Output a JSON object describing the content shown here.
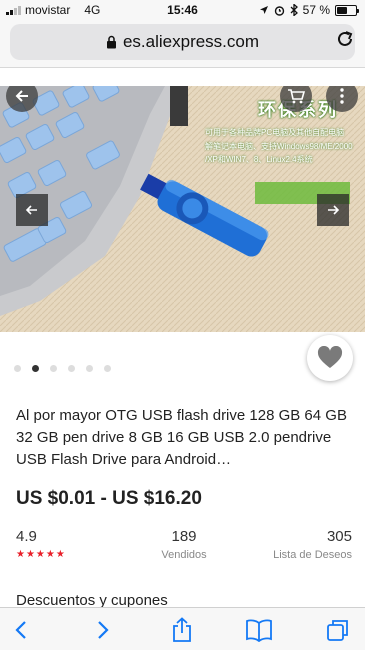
{
  "status_bar": {
    "carrier": "movistar",
    "network": "4G",
    "time": "15:46",
    "battery_percent": "57 %",
    "battery_level": 0.57
  },
  "browser": {
    "url": "es.aliexpress.com"
  },
  "gallery": {
    "image_text_title": "环保系列",
    "image_text_line1": "可用于各种品牌PC电脑及其他自配电脑",
    "image_text_line2": "解笔记本电脑、支持Windows98/ME/2000",
    "image_text_line3": "/XP和WIN7、8、Linux2.4系统",
    "dot_count": 6,
    "active_dot": 1
  },
  "product": {
    "title": "Al por mayor OTG USB flash drive 128 GB 64 GB 32 GB pen drive 8 GB 16 GB USB 2.0 pendrive USB Flash Drive para Android…",
    "price": "US $0.01 - US $16.20"
  },
  "stats": {
    "rating": "4.9",
    "stars": "★★★★★",
    "sold_count": "189",
    "sold_label": "Vendidos",
    "wish_count": "305",
    "wish_label": "Lista de Deseos"
  },
  "sections": {
    "discounts": "Descuentos y cupones"
  },
  "colors": {
    "accent_blue": "#1479f5",
    "star_red": "#e8202a"
  }
}
